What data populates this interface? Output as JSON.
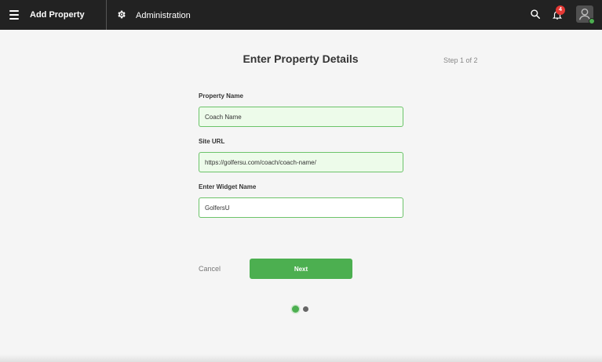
{
  "topbar": {
    "app_title": "Add Property",
    "admin_label": "Administration",
    "notifications_count": "4",
    "icons": {
      "menu": "hamburger-menu-icon",
      "gear": "gear-icon",
      "search": "search-icon",
      "bell": "bell-icon",
      "avatar": "user-avatar-icon"
    }
  },
  "main": {
    "title": "Enter Property Details",
    "step": "Step 1 of 2",
    "fields": [
      {
        "label": "Property Name",
        "value": "Coach Name"
      },
      {
        "label": "Site URL",
        "value": "https://golfersu.com/coach/coach-name/"
      },
      {
        "label": "Enter Widget Name",
        "value": "GolfersU"
      }
    ],
    "cancel_label": "Cancel",
    "next_label": "Next",
    "step_indicator": {
      "total": 2,
      "current": 1
    }
  },
  "colors": {
    "accent": "#4caf50",
    "topbar_bg": "#222222",
    "badge": "#e53935",
    "valid_field_bg": "#edfbea"
  }
}
